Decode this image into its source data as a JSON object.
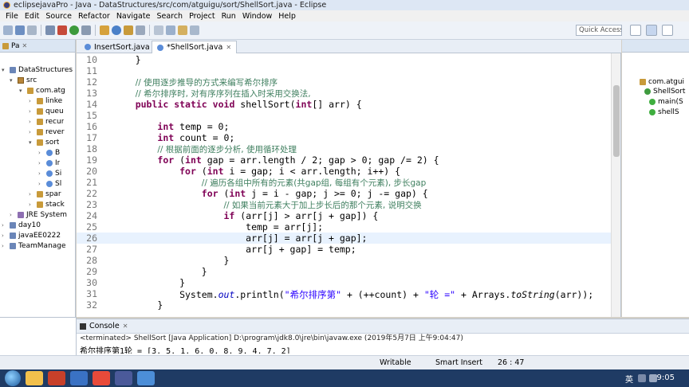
{
  "window": {
    "title": "eclipsejavaPro - Java - DataStructures/src/com/atguigu/sort/ShellSort.java - Eclipse"
  },
  "menu": [
    "File",
    "Edit",
    "Source",
    "Refactor",
    "Navigate",
    "Search",
    "Project",
    "Run",
    "Window",
    "Help"
  ],
  "quick_access": "Quick Access",
  "explorer": {
    "tab_label": "Pa",
    "items": [
      "DataStructures",
      "src",
      "com.atg",
      "linke",
      "queu",
      "recur",
      "rever",
      "sort",
      "B",
      "Ir",
      "Si",
      "Sl",
      "spar",
      "stack",
      "JRE System",
      "day10",
      "javaEE0222",
      "TeamManage"
    ]
  },
  "editor": {
    "tabs": [
      {
        "label": "InsertSort.java"
      },
      {
        "label": "*ShellSort.java"
      }
    ],
    "lines": [
      {
        "n": "10",
        "t": "    }"
      },
      {
        "n": "11",
        "t": ""
      },
      {
        "n": "12",
        "t": "    // 使用逐步推导的方式来编写希尔排序"
      },
      {
        "n": "13",
        "t": "    // 希尔排序时, 对有序序列在插入时采用交换法,"
      },
      {
        "n": "14",
        "t": "    public static void shellSort(int[] arr) {"
      },
      {
        "n": "15",
        "t": ""
      },
      {
        "n": "16",
        "t": "        int temp = 0;"
      },
      {
        "n": "17",
        "t": "        int count = 0;"
      },
      {
        "n": "18",
        "t": "        // 根据前面的逐步分析, 使用循环处理"
      },
      {
        "n": "19",
        "t": "        for (int gap = arr.length / 2; gap > 0; gap /= 2) {"
      },
      {
        "n": "20",
        "t": "            for (int i = gap; i < arr.length; i++) {"
      },
      {
        "n": "21",
        "t": "                // 遍历各组中所有的元素(共gap组, 每组有个元素), 步长gap"
      },
      {
        "n": "22",
        "t": "                for (int j = i - gap; j >= 0; j -= gap) {"
      },
      {
        "n": "23",
        "t": "                    // 如果当前元素大于加上步长后的那个元素, 说明交换"
      },
      {
        "n": "24",
        "t": "                    if (arr[j] > arr[j + gap]) {"
      },
      {
        "n": "25",
        "t": "                        temp = arr[j];"
      },
      {
        "n": "26",
        "t": "                        arr[j] = arr[j + gap];"
      },
      {
        "n": "27",
        "t": "                        arr[j + gap] = temp;"
      },
      {
        "n": "28",
        "t": "                    }"
      },
      {
        "n": "29",
        "t": "                }"
      },
      {
        "n": "30",
        "t": "            }"
      },
      {
        "n": "31",
        "t": "            System.out.println(\"希尔排序第\" + (++count) + \"轮 =\" + Arrays.toString(arr));"
      },
      {
        "n": "32",
        "t": "        }"
      }
    ]
  },
  "outline": {
    "items": [
      "com.atgui",
      "ShellSort",
      "main(S",
      "shellS"
    ]
  },
  "console": {
    "tab_label": "Console",
    "status": "<terminated> ShellSort [Java Application] D:\\program\\jdk8.0\\jre\\bin\\javaw.exe (2019年5月7日 上午9:04:47)",
    "output": "希尔排序第1轮 = [3, 5, 1, 6, 0, 8, 9, 4, 7, 2]"
  },
  "statusbar": {
    "writable": "Writable",
    "insert_mode": "Smart Insert",
    "position": "26 : 47"
  },
  "taskbar": {
    "time": "9:05",
    "ime": "英"
  }
}
